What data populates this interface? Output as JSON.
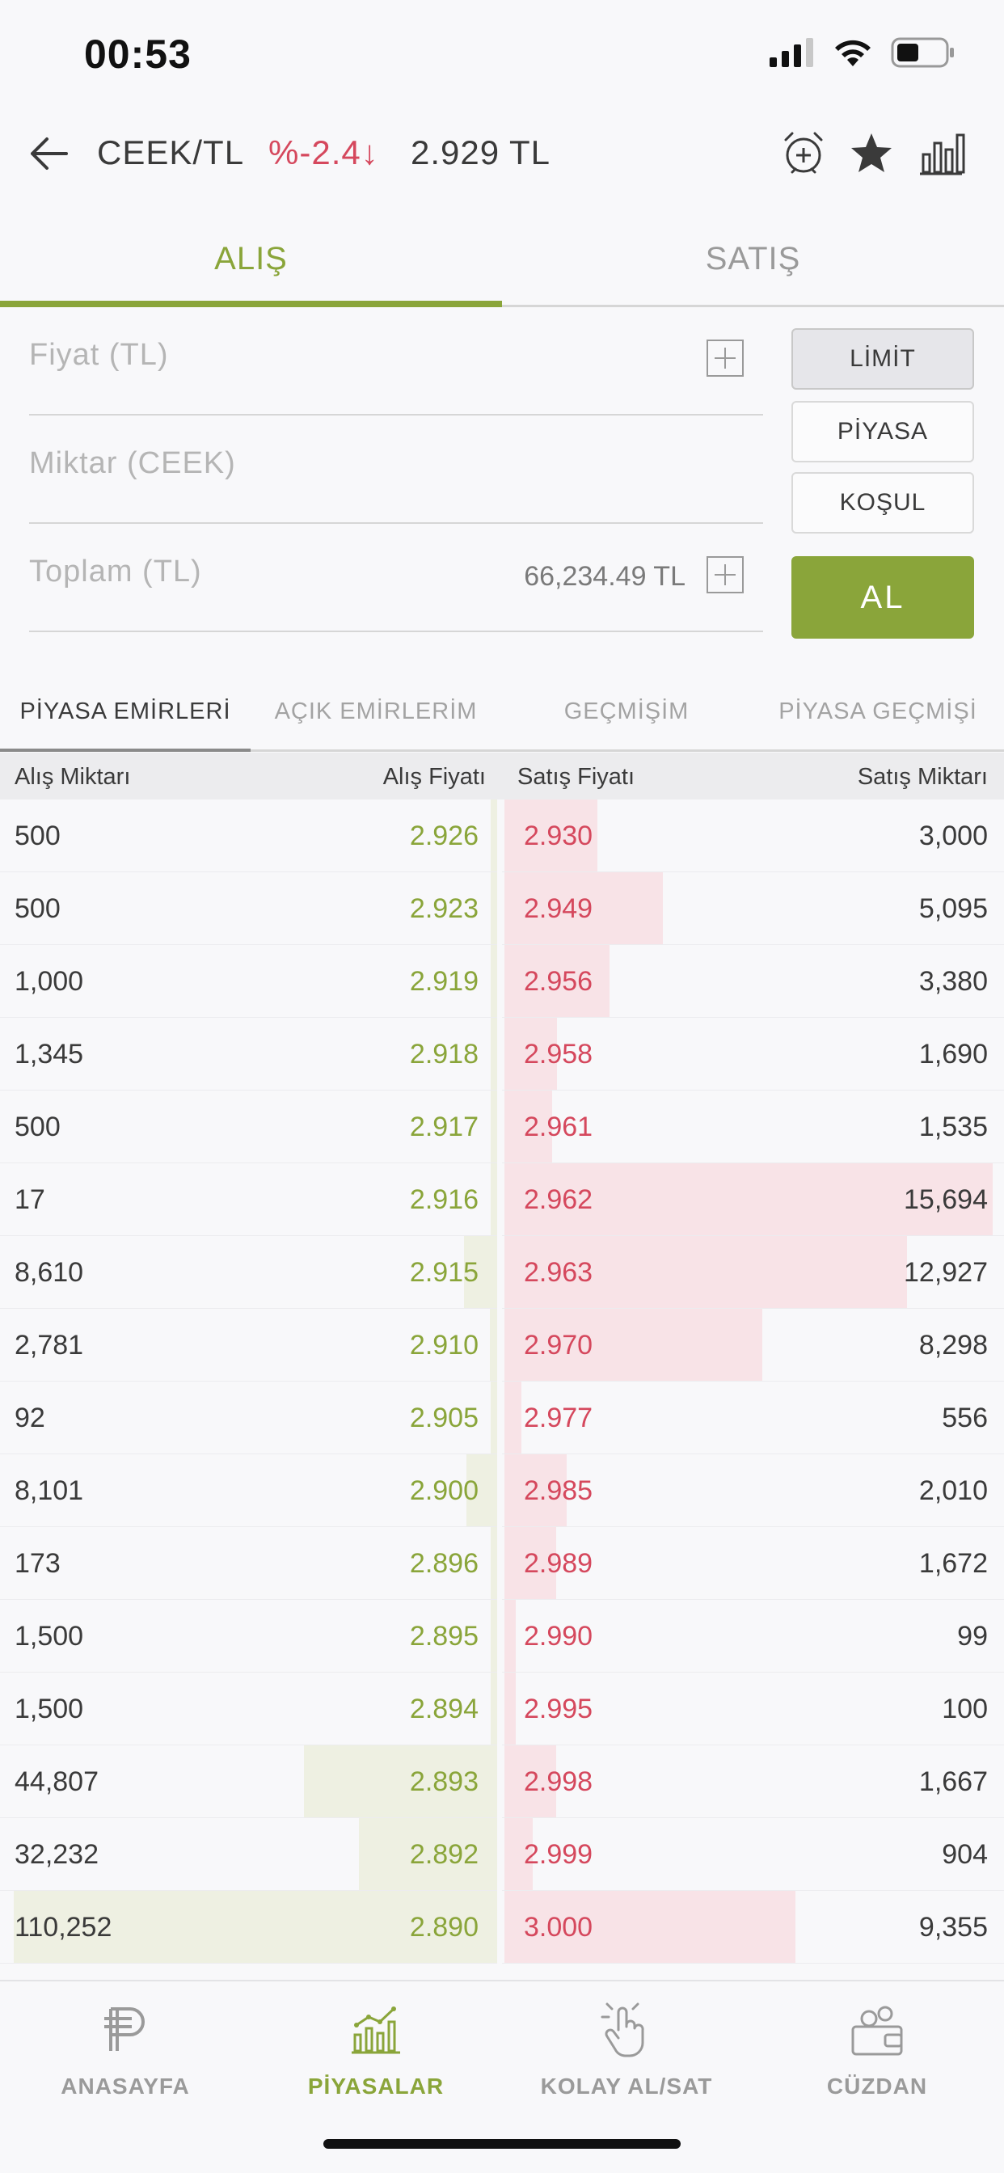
{
  "status": {
    "time": "00:53"
  },
  "header": {
    "pair": "CEEK/TL",
    "change": "%-2.4",
    "change_arrow": "↓",
    "price": "2.929 TL"
  },
  "tabs": {
    "buy": "ALIŞ",
    "sell": "SATIŞ",
    "active": "buy"
  },
  "form": {
    "price_label": "Fiyat (TL)",
    "amount_label": "Miktar (CEEK)",
    "total_label": "Toplam (TL)",
    "total_value": "66,234.49 TL",
    "order_types": [
      "LİMİT",
      "PİYASA",
      "KOŞUL"
    ],
    "active_order_type": "LİMİT",
    "submit": "AL"
  },
  "section_tabs": [
    "PİYASA EMİRLERİ",
    "AÇIK EMİRLERİM",
    "GEÇMİŞİM",
    "PİYASA GEÇMİŞİ"
  ],
  "order_book": {
    "headers": {
      "buy_qty": "Alış Miktarı",
      "buy_price": "Alış Fiyatı",
      "sell_price": "Satış Fiyatı",
      "sell_qty": "Satış Miktarı"
    },
    "rows": [
      {
        "buy_qty": "500",
        "buy_price": "2.926",
        "sell_price": "2.930",
        "sell_qty": "3,000"
      },
      {
        "buy_qty": "500",
        "buy_price": "2.923",
        "sell_price": "2.949",
        "sell_qty": "5,095"
      },
      {
        "buy_qty": "1,000",
        "buy_price": "2.919",
        "sell_price": "2.956",
        "sell_qty": "3,380"
      },
      {
        "buy_qty": "1,345",
        "buy_price": "2.918",
        "sell_price": "2.958",
        "sell_qty": "1,690"
      },
      {
        "buy_qty": "500",
        "buy_price": "2.917",
        "sell_price": "2.961",
        "sell_qty": "1,535"
      },
      {
        "buy_qty": "17",
        "buy_price": "2.916",
        "sell_price": "2.962",
        "sell_qty": "15,694"
      },
      {
        "buy_qty": "8,610",
        "buy_price": "2.915",
        "sell_price": "2.963",
        "sell_qty": "12,927"
      },
      {
        "buy_qty": "2,781",
        "buy_price": "2.910",
        "sell_price": "2.970",
        "sell_qty": "8,298"
      },
      {
        "buy_qty": "92",
        "buy_price": "2.905",
        "sell_price": "2.977",
        "sell_qty": "556"
      },
      {
        "buy_qty": "8,101",
        "buy_price": "2.900",
        "sell_price": "2.985",
        "sell_qty": "2,010"
      },
      {
        "buy_qty": "173",
        "buy_price": "2.896",
        "sell_price": "2.989",
        "sell_qty": "1,672"
      },
      {
        "buy_qty": "1,500",
        "buy_price": "2.895",
        "sell_price": "2.990",
        "sell_qty": "99"
      },
      {
        "buy_qty": "1,500",
        "buy_price": "2.894",
        "sell_price": "2.995",
        "sell_qty": "100"
      },
      {
        "buy_qty": "44,807",
        "buy_price": "2.893",
        "sell_price": "2.998",
        "sell_qty": "1,667"
      },
      {
        "buy_qty": "32,232",
        "buy_price": "2.892",
        "sell_price": "2.999",
        "sell_qty": "904"
      },
      {
        "buy_qty": "110,252",
        "buy_price": "2.890",
        "sell_price": "3.000",
        "sell_qty": "9,355"
      }
    ]
  },
  "bottom_nav": {
    "items": [
      {
        "label": "ANASAYFA",
        "icon": "lira-icon"
      },
      {
        "label": "PİYASALAR",
        "icon": "market-chart-icon"
      },
      {
        "label": "KOLAY AL/SAT",
        "icon": "tap-hand-icon"
      },
      {
        "label": "CÜZDAN",
        "icon": "wallet-icon"
      }
    ],
    "active": "PİYASALAR"
  },
  "colors": {
    "accent_green": "#8aa53a",
    "sell_red": "#d5485d",
    "buy_depth": "#eef0e2",
    "sell_depth": "#f8e3e7"
  }
}
